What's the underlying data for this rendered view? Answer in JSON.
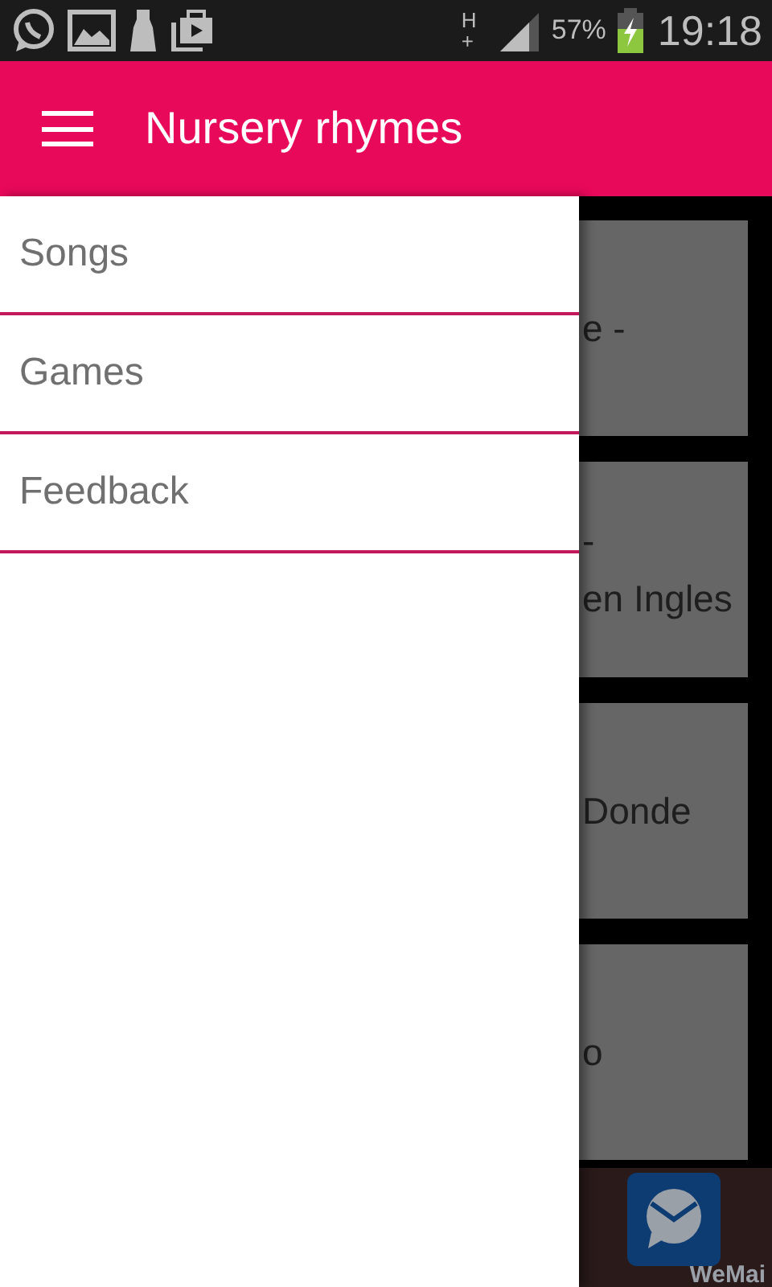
{
  "status_bar": {
    "network": "H+",
    "battery": "57%",
    "time": "19:18"
  },
  "app_bar": {
    "title": "Nursery rhymes"
  },
  "drawer": {
    "items": [
      {
        "label": "Songs"
      },
      {
        "label": "Games"
      },
      {
        "label": "Feedback"
      }
    ]
  },
  "cards": [
    {
      "lines": [
        "e -"
      ]
    },
    {
      "lines": [
        "-",
        "en Ingles"
      ]
    },
    {
      "lines": [
        "Donde"
      ]
    },
    {
      "lines": [
        "o"
      ]
    }
  ],
  "ad_banner": {
    "text": "WeMai"
  }
}
